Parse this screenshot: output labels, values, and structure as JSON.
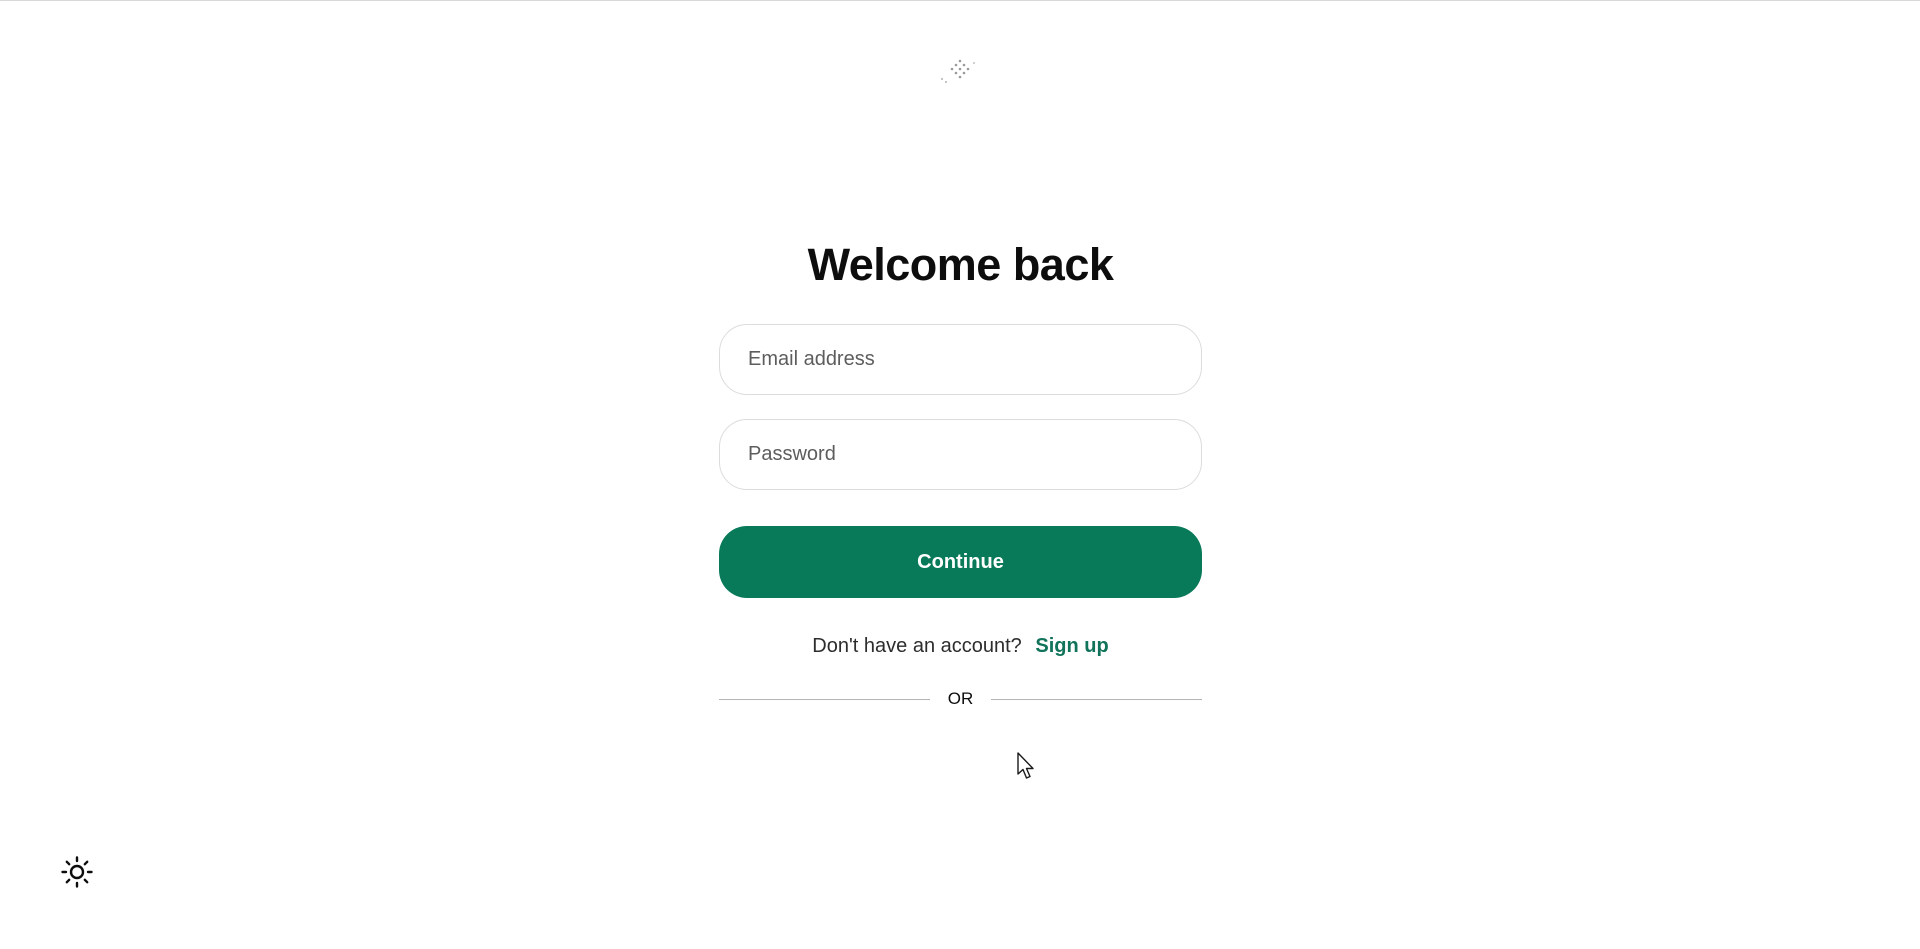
{
  "logo": {
    "icon": "dotted-diamond-logo-icon"
  },
  "title": "Welcome back",
  "email": {
    "placeholder": "Email address",
    "value": ""
  },
  "password": {
    "placeholder": "Password",
    "value": ""
  },
  "continue_label": "Continue",
  "signup": {
    "prompt": "Don't have an account?",
    "link_label": "Sign up"
  },
  "divider_text": "OR",
  "theme_toggle": {
    "icon": "sun-icon"
  },
  "colors": {
    "accent": "#087a59",
    "link": "#10735a"
  }
}
